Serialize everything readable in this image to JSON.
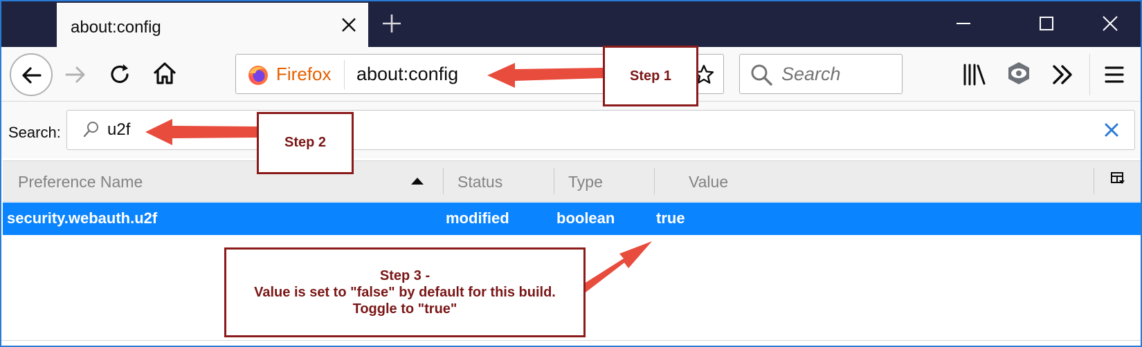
{
  "window": {
    "tab_title": "about:config",
    "new_tab_icon": "plus-icon",
    "minimize_icon": "minimize-icon",
    "maximize_icon": "maximize-icon",
    "close_icon": "close-icon"
  },
  "navbar": {
    "identity_label": "Firefox",
    "url": "about:config",
    "search_placeholder": "Search",
    "icons": [
      "back-icon",
      "forward-icon",
      "reload-icon",
      "home-icon",
      "firefox-logo",
      "bookmark-star-icon",
      "search-icon",
      "library-icon",
      "tracking-protection-icon",
      "overflow-chevron-icon",
      "hamburger-menu-icon"
    ]
  },
  "config_search": {
    "label": "Search:",
    "value": "u2f"
  },
  "table": {
    "headers": [
      "Preference Name",
      "Status",
      "Type",
      "Value"
    ],
    "sort_column": "Preference Name",
    "sort_direction": "ascending",
    "rows": [
      {
        "name": "security.webauth.u2f",
        "status": "modified",
        "type": "boolean",
        "value": "true",
        "selected": true
      }
    ]
  },
  "annotations": {
    "step1": "Step 1",
    "step2": "Step 2",
    "step3_line1": "Step 3 -",
    "step3_line2": "Value is set to \"false\" by default for this build.",
    "step3_line3": "Toggle to \"true\""
  },
  "colors": {
    "titlebar": "#1f2340",
    "selection": "#0a84ff",
    "annotation_border": "#8b1a1a",
    "arrow": "#e74c3c",
    "firefox_orange": "#e66000"
  }
}
